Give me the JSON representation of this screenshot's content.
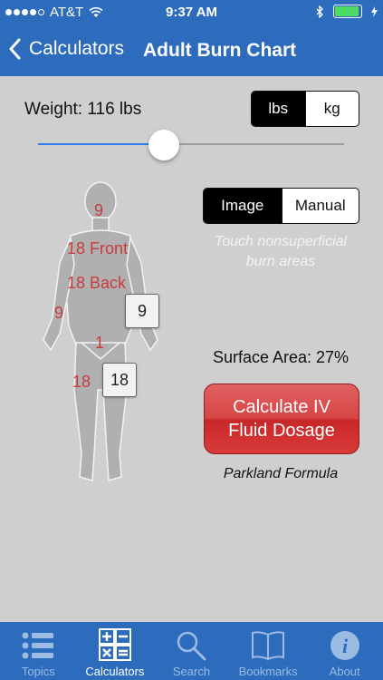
{
  "status_bar": {
    "carrier": "AT&T",
    "time": "9:37 AM",
    "signal_bars_filled": 4,
    "signal_bars_total": 5,
    "battery_level": 0.85
  },
  "nav": {
    "back_label": "Calculators",
    "title": "Adult Burn Chart"
  },
  "weight": {
    "label": "Weight: 116 lbs",
    "slider_value": 0.4,
    "units": [
      {
        "label": "lbs",
        "active": true
      },
      {
        "label": "kg",
        "active": false
      }
    ]
  },
  "mode": {
    "options": [
      {
        "label": "Image",
        "active": true
      },
      {
        "label": "Manual",
        "active": false
      }
    ],
    "hint_line1": "Touch nonsuperficial",
    "hint_line2": "burn areas"
  },
  "body_zones": {
    "head": "9",
    "front": "18 Front",
    "back": "18 Back",
    "right_arm": "9",
    "left_arm": "9",
    "groin": "1",
    "right_leg": "18",
    "left_leg": "18"
  },
  "surface_area": "Surface Area: 27%",
  "calculate": {
    "line1": "Calculate IV",
    "line2": "Fluid Dosage"
  },
  "formula": "Parkland Formula",
  "tabs": [
    {
      "label": "Topics",
      "icon": "list-icon",
      "active": false
    },
    {
      "label": "Calculators",
      "icon": "calculator-icon",
      "active": true
    },
    {
      "label": "Search",
      "icon": "search-icon",
      "active": false
    },
    {
      "label": "Bookmarks",
      "icon": "book-icon",
      "active": false
    },
    {
      "label": "About",
      "icon": "info-icon",
      "active": false
    }
  ],
  "colors": {
    "brand_blue": "#2d6cbc",
    "burn_red": "#c83c3c",
    "button_red": "#d64545",
    "slider_blue": "#2f7ef0"
  }
}
